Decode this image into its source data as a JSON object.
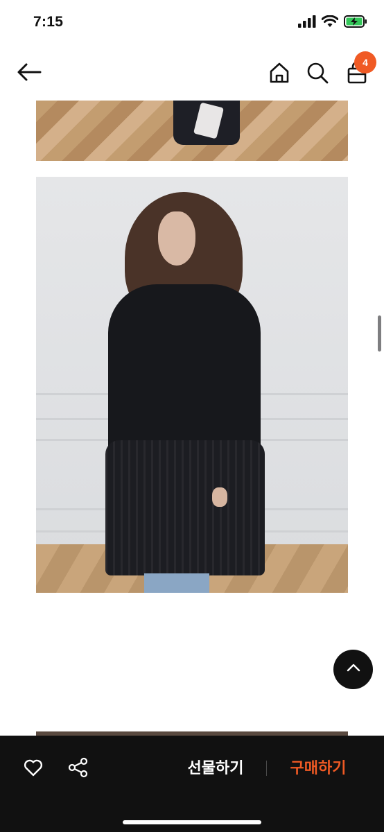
{
  "status_bar": {
    "time": "7:15",
    "icons": [
      "signal-icon",
      "wifi-icon",
      "battery-charging-icon"
    ]
  },
  "nav": {
    "icons": [
      "back-arrow-icon",
      "home-icon",
      "search-icon",
      "shopping-bag-icon"
    ],
    "cart_count": "4"
  },
  "bottom_bar": {
    "gift_label": "선물하기",
    "buy_label": "구매하기",
    "icons": [
      "heart-icon",
      "share-icon"
    ]
  },
  "colors": {
    "accent": "#f05a24",
    "bottom_bar_bg": "#111111"
  }
}
